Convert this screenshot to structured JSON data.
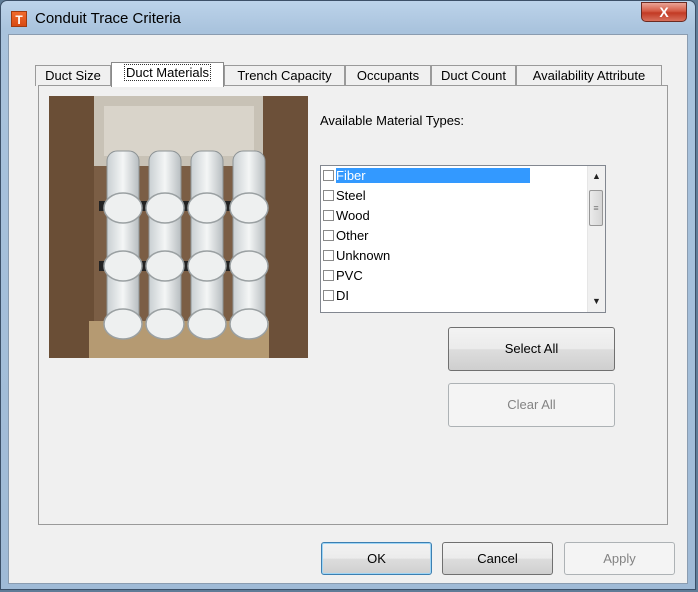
{
  "window": {
    "title": "Conduit Trace Criteria",
    "app_icon_letter": "T",
    "close_glyph": "X"
  },
  "tabs": [
    {
      "label": "Duct Size"
    },
    {
      "label": "Duct Materials"
    },
    {
      "label": "Trench Capacity"
    },
    {
      "label": "Occupants"
    },
    {
      "label": "Duct Count"
    },
    {
      "label": "Availability Attribute"
    }
  ],
  "active_tab": "Duct Materials",
  "materials": {
    "label": "Available Material Types:",
    "items": [
      {
        "label": "Fiber",
        "checked": false,
        "selected": true
      },
      {
        "label": "Steel",
        "checked": false,
        "selected": false
      },
      {
        "label": "Wood",
        "checked": false,
        "selected": false
      },
      {
        "label": "Other",
        "checked": false,
        "selected": false
      },
      {
        "label": "Unknown",
        "checked": false,
        "selected": false
      },
      {
        "label": "PVC",
        "checked": false,
        "selected": false
      },
      {
        "label": "DI",
        "checked": false,
        "selected": false
      }
    ]
  },
  "buttons": {
    "select_all": "Select All",
    "clear_all": "Clear All",
    "ok": "OK",
    "cancel": "Cancel",
    "apply": "Apply"
  },
  "colors": {
    "selection": "#3399ff",
    "close_red": "#c23a24",
    "title_gradient": "#a9c3dd"
  }
}
